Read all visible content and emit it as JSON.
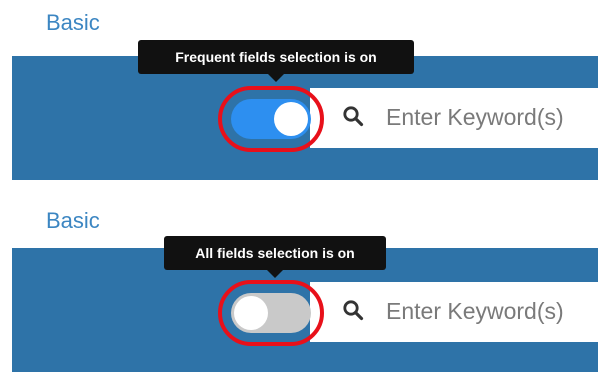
{
  "panels": [
    {
      "tab_label": "Basic",
      "tooltip": "Frequent fields selection is on",
      "toggle_state": "on",
      "search_placeholder": "Enter Keyword(s)",
      "search_icon": "search-icon"
    },
    {
      "tab_label": "Basic",
      "tooltip": "All fields selection is on",
      "toggle_state": "off",
      "search_placeholder": "Enter Keyword(s)",
      "search_icon": "search-icon"
    }
  ],
  "colors": {
    "tab_text": "#3c86c2",
    "bar": "#2e73a8",
    "toggle_on": "#2d8ff0",
    "toggle_off": "#c9c9c9",
    "highlight_ring": "#e8101a",
    "tooltip_bg": "#111111"
  }
}
